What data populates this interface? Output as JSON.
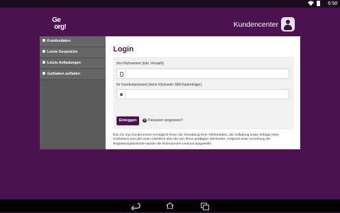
{
  "status_bar": {
    "time": "6:58"
  },
  "header": {
    "logo_line1": "Ge",
    "logo_line2": "org!",
    "title": "Kundencenter",
    "avatar_icon": "user-icon"
  },
  "sidebar": {
    "items": [
      {
        "label": "Kundendaten",
        "icon": "lock-icon"
      },
      {
        "label": "Letzte Gespräche",
        "icon": "lock-icon"
      },
      {
        "label": "Letzte Aufladungen",
        "icon": "lock-icon"
      },
      {
        "label": "Guthaben aufladen",
        "icon": "lock-icon"
      }
    ]
  },
  "login": {
    "title": "Login",
    "phone_label": "Ihre Rufnummer (inkl. Vorwahl)",
    "phone_value": "",
    "phone_icon": "phone-icon",
    "password_label": "Ihr Kundenkennwort (siehe Rückseite SIM-Kartenträger)",
    "password_value": "",
    "password_icon": "lock-icon",
    "submit_label": "Einloggen",
    "forgot_label": "Passwort vergessen?",
    "forgot_icon": "question-icon"
  },
  "info_text": "Das Ge org! Kundencenter ermöglicht Ihnen die Verwaltung Ihrer Telefondaten, die Aufladung sowie Abfrage Ihres Guthabens und gibt einen Überblick über die von Ihnen getätigten Telefonate. Aufgrund einer Anordnung der Regulierungsbehörde werden die Rufnummern verkürzt dargestellt!",
  "nav_bar": {
    "back_icon": "back-icon",
    "home_icon": "home-icon",
    "recents_icon": "recents-icon"
  },
  "colors": {
    "brand": "#4b1250",
    "sidebar": "#5b5b5b",
    "panel": "#f2f1f2"
  }
}
